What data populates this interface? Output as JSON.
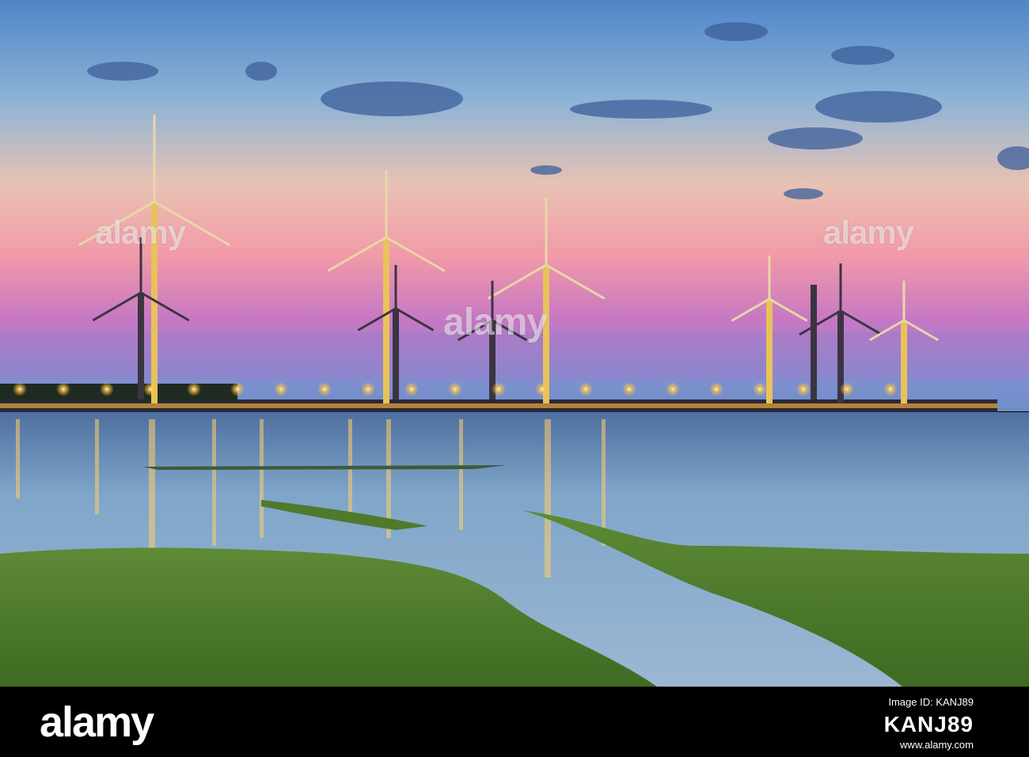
{
  "photo": {
    "subject": "",
    "watermark_text": "alamy"
  },
  "footer": {
    "logo": "alamy",
    "id_label": "Image ID: KANJ89",
    "image_id": "KANJ89",
    "url": "www.alamy.com"
  },
  "colors": {
    "sky_top": "#5d86c8",
    "sky_mid": "#f2b7a3",
    "sky_pink": "#d86fb0",
    "water": "#7fa6c9",
    "grass": "#4f7a2c",
    "lights": "#ffc340"
  }
}
